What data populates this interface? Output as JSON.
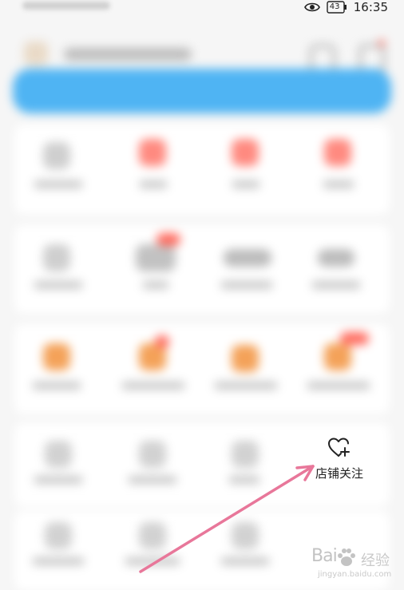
{
  "status_bar": {
    "battery_level": "43",
    "time": "16:35"
  },
  "store_follow": {
    "label": "店铺关注",
    "icon": "heart-plus-icon"
  },
  "watermark": {
    "brand": "Bai",
    "brand_cn": "经验",
    "url": "jingyan.baidu.com"
  },
  "colors": {
    "banner": "#4fb4f3",
    "arrow": "#e8779a",
    "badge": "#ff6b5f",
    "tile_orange": "#f4a259",
    "tile_red": "#ff8a80"
  }
}
